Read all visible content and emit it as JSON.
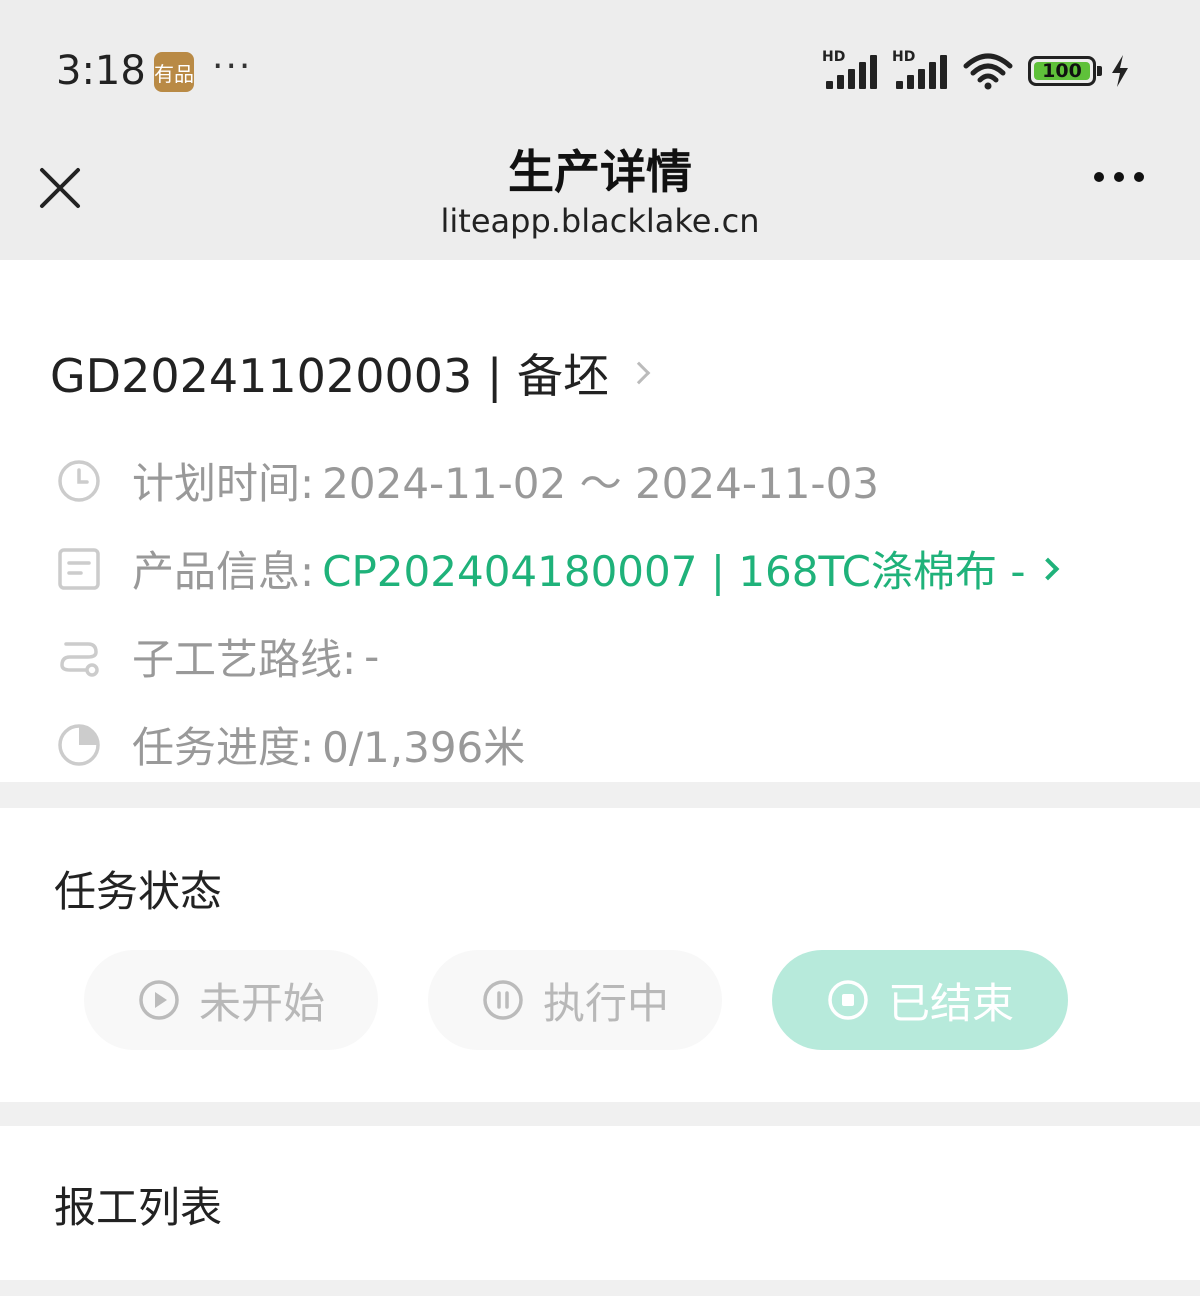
{
  "statusbar": {
    "time": "3:18",
    "badge": "有品",
    "dots": "···",
    "signal1_label": "HD",
    "signal2_label": "HD",
    "battery": "100"
  },
  "navbar": {
    "title": "生产详情",
    "url": "liteapp.blacklake.cn"
  },
  "order": {
    "title": "GD202411020003 | 备坯"
  },
  "info": {
    "plan_time_label": "计划时间:",
    "plan_time_value": "2024-11-02 ～ 2024-11-03",
    "product_label": "产品信息:",
    "product_value": "CP202404180007 | 168TC涤棉布 -",
    "route_label": "子工艺路线:",
    "route_value": "-",
    "progress_label": "任务进度:",
    "progress_value": "0/1,396米"
  },
  "task_status": {
    "title": "任务状态",
    "not_started": "未开始",
    "in_progress": "执行中",
    "finished": "已结束",
    "active": "已结束"
  },
  "report_list": {
    "title": "报工列表"
  },
  "colors": {
    "accent": "#1fb27a",
    "active_status_bg": "#b7eadb",
    "header_bg": "#ededed"
  }
}
